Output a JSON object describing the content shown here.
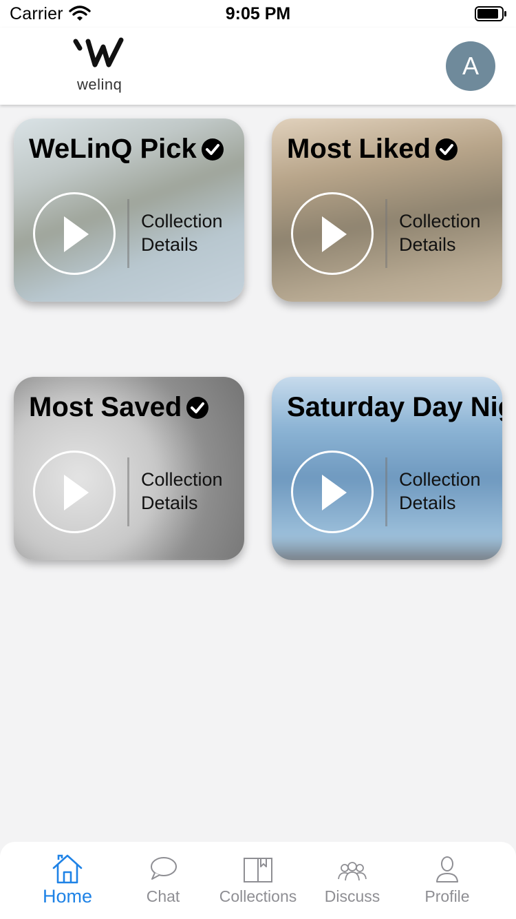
{
  "status_bar": {
    "carrier": "Carrier",
    "time": "9:05 PM"
  },
  "header": {
    "logo_text": "welinq",
    "avatar_initial": "A",
    "avatar_color": "#6f8a9b"
  },
  "collections": [
    {
      "title": "WeLinQ Pick",
      "verified": true,
      "details_line1": "Collection",
      "details_line2": "Details"
    },
    {
      "title": "Most Liked",
      "verified": true,
      "details_line1": "Collection",
      "details_line2": "Details"
    },
    {
      "title": "Most Saved",
      "verified": true,
      "details_line1": "Collection",
      "details_line2": "Details"
    },
    {
      "title": "Saturday Day Nig",
      "verified": false,
      "details_line1": "Collection",
      "details_line2": "Details"
    }
  ],
  "tab_bar": {
    "active_color": "#1e82e6",
    "inactive_color": "#8e8e93",
    "tabs": [
      {
        "label": "Home",
        "icon": "home-icon",
        "active": true
      },
      {
        "label": "Chat",
        "icon": "chat-bubble-icon",
        "active": false
      },
      {
        "label": "Collections",
        "icon": "book-icon",
        "active": false
      },
      {
        "label": "Discuss",
        "icon": "group-icon",
        "active": false
      },
      {
        "label": "Profile",
        "icon": "person-icon",
        "active": false
      }
    ]
  }
}
